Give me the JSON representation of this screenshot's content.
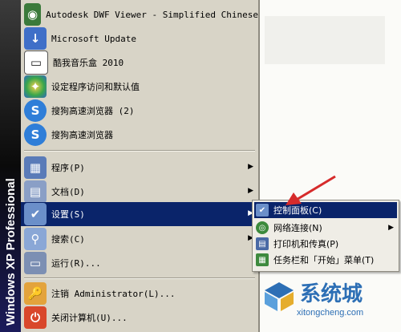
{
  "banner": {
    "text": "Windows XP Professional"
  },
  "menu": {
    "programs": [
      {
        "label": "Autodesk DWF Viewer - Simplified Chinese",
        "icon": "dwf-viewer-icon"
      },
      {
        "label": "Microsoft Update",
        "icon": "microsoft-update-icon"
      },
      {
        "label": "酷我音乐盒 2010",
        "icon": "kuwo-music-icon"
      },
      {
        "label": "设定程序访问和默认值",
        "icon": "program-access-icon"
      },
      {
        "label": "搜狗高速浏览器 (2)",
        "icon": "sogou-browser-icon"
      },
      {
        "label": "搜狗高速浏览器",
        "icon": "sogou-browser-icon"
      }
    ],
    "main": [
      {
        "label": "程序(P)",
        "icon": "programs-icon",
        "arrow": "▶"
      },
      {
        "label": "文档(D)",
        "icon": "documents-icon",
        "arrow": "▶"
      },
      {
        "label": "设置(S)",
        "icon": "settings-icon",
        "arrow": "▶"
      },
      {
        "label": "搜索(C)",
        "icon": "search-icon",
        "arrow": "▶"
      },
      {
        "label": "运行(R)...",
        "icon": "run-icon"
      }
    ],
    "bottom": [
      {
        "label": "注销 Administrator(L)...",
        "icon": "logoff-icon"
      },
      {
        "label": "关闭计算机(U)...",
        "icon": "shutdown-icon"
      }
    ]
  },
  "submenu": {
    "items": [
      {
        "label": "控制面板(C)",
        "icon": "control-panel-icon"
      },
      {
        "label": "网络连接(N)",
        "icon": "network-icon",
        "arrow": "▶"
      },
      {
        "label": "打印机和传真(P)",
        "icon": "printer-icon"
      },
      {
        "label": "任务栏和「开始」菜单(T)",
        "icon": "taskbar-icon"
      }
    ]
  },
  "watermark": {
    "text": "系统城",
    "url": "xitongcheng.com"
  },
  "colors": {
    "highlight": "#0a246a",
    "menu_bg": "#d8d4c7",
    "accent_blue": "#2d6fb5",
    "arrow_red": "#d62b2b"
  }
}
